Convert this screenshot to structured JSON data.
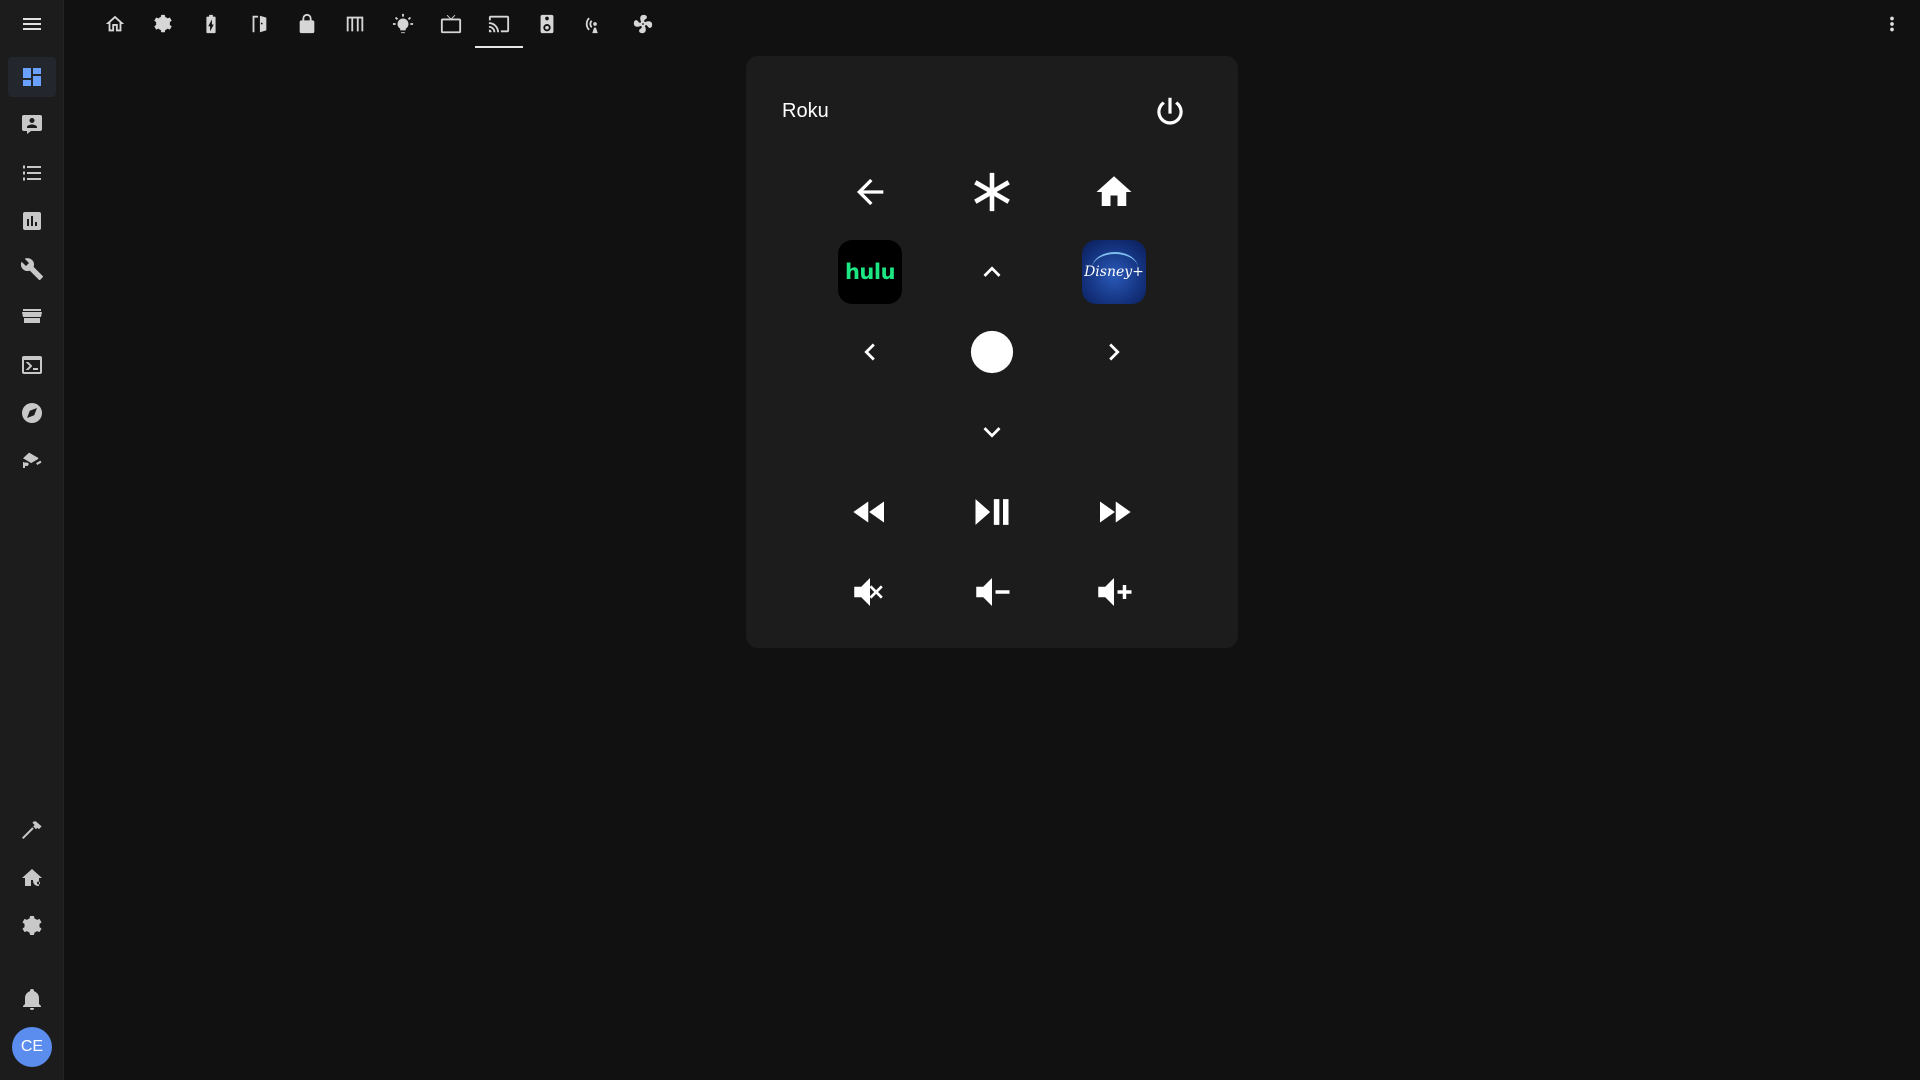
{
  "sidebar": {
    "items": [
      {
        "name": "overview",
        "icon": "view-dashboard-icon"
      },
      {
        "name": "map",
        "icon": "account-box-icon"
      },
      {
        "name": "logbook",
        "icon": "format-list-bulleted-icon"
      },
      {
        "name": "history",
        "icon": "chart-box-icon"
      },
      {
        "name": "config-tools",
        "icon": "wrench-icon"
      },
      {
        "name": "hacs",
        "icon": "store-icon"
      },
      {
        "name": "terminal",
        "icon": "console-icon"
      },
      {
        "name": "media",
        "icon": "compass-icon"
      },
      {
        "name": "cameras",
        "icon": "cctv-icon"
      }
    ],
    "bottom_items": [
      {
        "name": "developer-tools",
        "icon": "hammer-icon"
      },
      {
        "name": "areas",
        "icon": "home-cog-icon"
      },
      {
        "name": "settings",
        "icon": "gear-icon"
      },
      {
        "name": "notifications",
        "icon": "bell-icon"
      }
    ],
    "user_initials": "CE",
    "accent_color": "#6aa0ff",
    "avatar_color": "#5b8def"
  },
  "toolbar": {
    "tabs": [
      {
        "name": "home",
        "icon": "home-outline-icon"
      },
      {
        "name": "settings",
        "icon": "gear-icon"
      },
      {
        "name": "battery",
        "icon": "battery-charging-icon"
      },
      {
        "name": "door",
        "icon": "door-open-icon"
      },
      {
        "name": "lock",
        "icon": "lock-icon"
      },
      {
        "name": "blinds",
        "icon": "blinds-icon"
      },
      {
        "name": "lights",
        "icon": "lightbulb-icon"
      },
      {
        "name": "tv",
        "icon": "television-icon"
      },
      {
        "name": "cast",
        "icon": "cast-icon",
        "active": true
      },
      {
        "name": "speaker",
        "icon": "speaker-icon"
      },
      {
        "name": "wifi",
        "icon": "access-point-icon"
      },
      {
        "name": "fan",
        "icon": "fan-icon"
      }
    ]
  },
  "remote": {
    "title": "Roku",
    "apps": [
      {
        "name": "hulu",
        "label": "hulu",
        "color": "#1ce783"
      },
      {
        "name": "disney-plus",
        "label": "Disney+",
        "color": "#14327e"
      }
    ],
    "buttons": [
      "back",
      "info",
      "home",
      "up",
      "left",
      "select",
      "right",
      "down",
      "rewind",
      "play-pause",
      "fast-forward",
      "mute",
      "volume-down",
      "volume-up",
      "power"
    ]
  }
}
